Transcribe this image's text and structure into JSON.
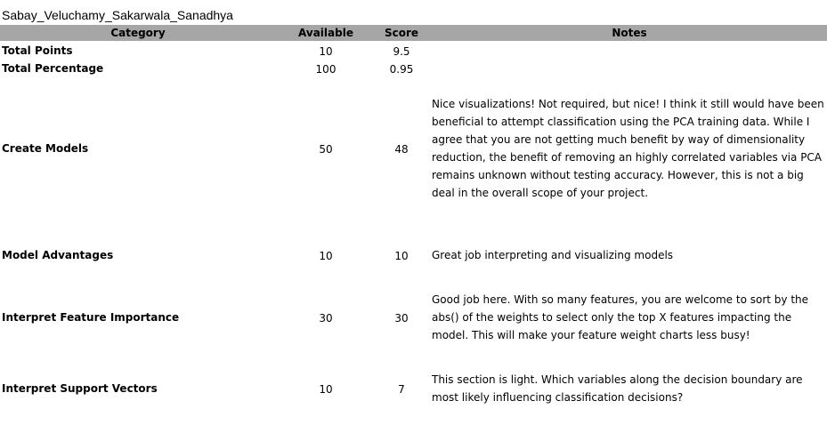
{
  "sheet_title": "Sabay_Veluchamy_Sakarwala_Sanadhya",
  "header": {
    "category": "Category",
    "available": "Available",
    "score": "Score",
    "notes": "Notes"
  },
  "rows": [
    {
      "category": "Total Points",
      "available": "10",
      "score": "9.5",
      "notes": ""
    },
    {
      "category": "Total Percentage",
      "available": "100",
      "score": "0.95",
      "notes": ""
    },
    {
      "category": "Create Models",
      "available": "50",
      "score": "48",
      "notes": "Nice visualizations!  Not required, but nice! I think it still would have been beneficial to attempt classification using the PCA training data.  While I agree that you are not getting much benefit by way of dimensionality reduction, the benefit of removing an highly correlated variables via PCA remains unknown without testing accuracy.  However, this is not a big deal in the overall scope of your project."
    },
    {
      "category": "Model Advantages",
      "available": "10",
      "score": "10",
      "notes": "Great job interpreting and visualizing  models"
    },
    {
      "category": "Interpret Feature Importance",
      "available": "30",
      "score": "30",
      "notes": "Good job here.  With so many features, you are welcome to sort by the abs() of the weights to select only the top X features impacting the model.  This will make your feature weight charts less busy!"
    },
    {
      "category": "Interpret Support Vectors",
      "available": "10",
      "score": "7",
      "notes": "This section is light.  Which variables along the decision boundary are most likely influencing classification decisions?"
    }
  ]
}
